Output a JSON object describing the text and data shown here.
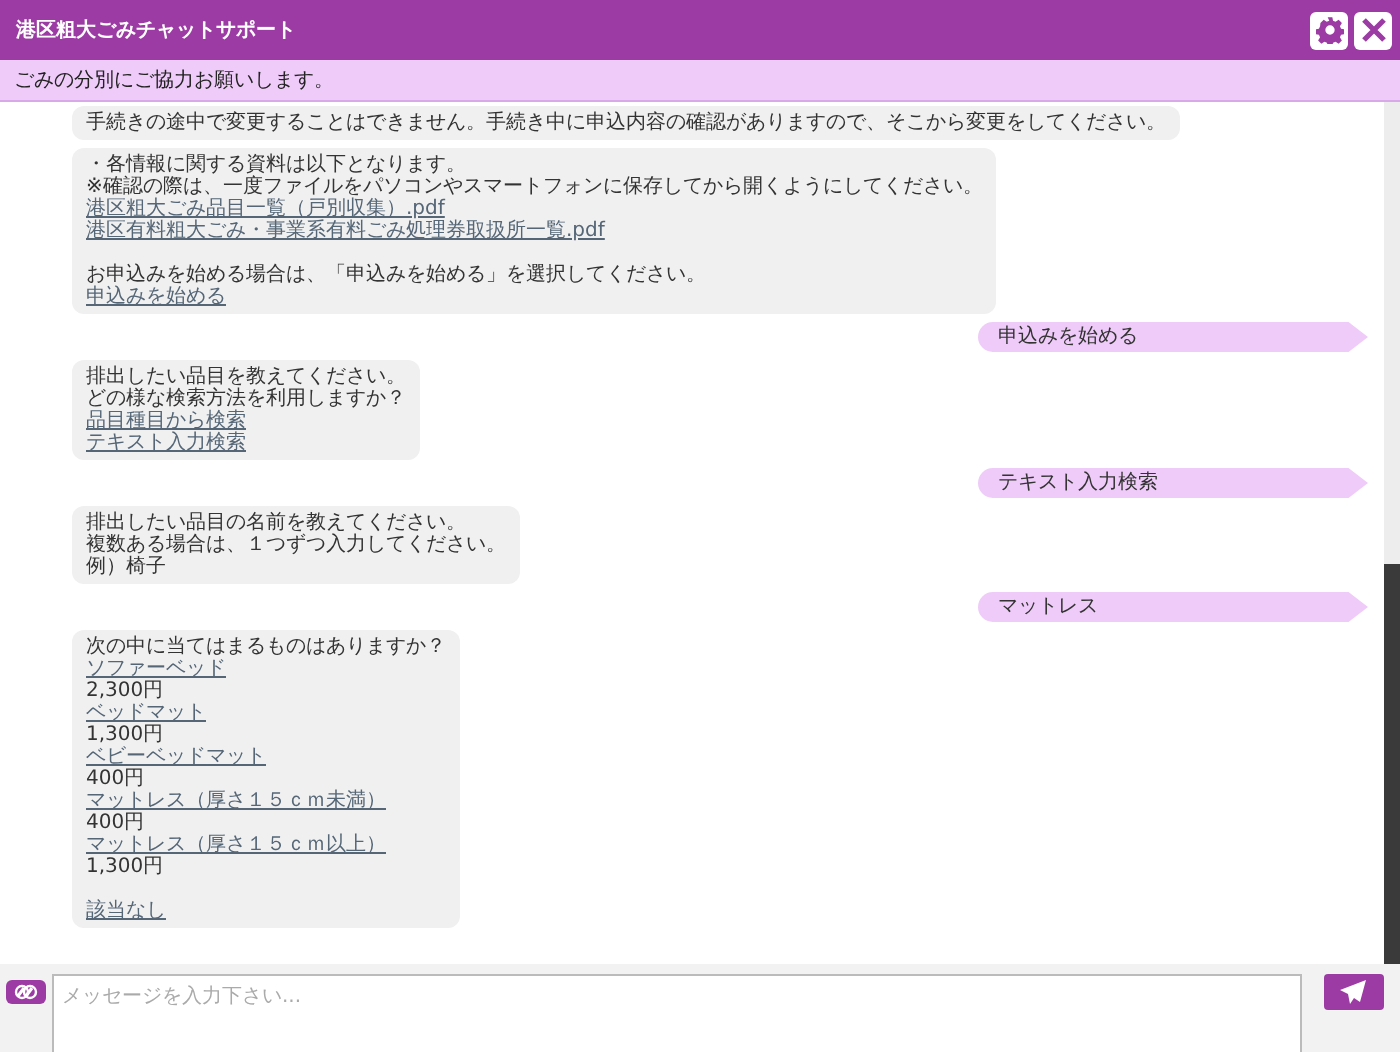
{
  "window": {
    "title": "港区粗大ごみチャットサポート"
  },
  "banner": "ごみの分別にご協力お願いします。",
  "messages": [
    {
      "kind": "bot",
      "lines": [
        {
          "kind": "text",
          "text": "手続きの途中で変更することはできません。手続き中に申込内容の確認がありますので、そこから変更をしてください。"
        }
      ]
    },
    {
      "kind": "bot",
      "lines": [
        {
          "kind": "text",
          "text": "・各情報に関する資料は以下となります。"
        },
        {
          "kind": "text",
          "text": "※確認の際は、一度ファイルをパソコンやスマートフォンに保存してから開くようにしてください。"
        },
        {
          "kind": "link",
          "text": "港区粗大ごみ品目一覧（戸別収集）.pdf"
        },
        {
          "kind": "link",
          "text": "港区有料粗大ごみ・事業系有料ごみ処理券取扱所一覧.pdf"
        },
        {
          "kind": "gap"
        },
        {
          "kind": "text",
          "text": "お申込みを始める場合は、「申込みを始める」を選択してください。"
        },
        {
          "kind": "link",
          "text": "申込みを始める"
        }
      ]
    },
    {
      "kind": "user",
      "text": "申込みを始める"
    },
    {
      "kind": "bot",
      "lines": [
        {
          "kind": "text",
          "text": "排出したい品目を教えてください。"
        },
        {
          "kind": "text",
          "text": "どの様な検索方法を利用しますか？"
        },
        {
          "kind": "link",
          "text": "品目種目から検索"
        },
        {
          "kind": "link",
          "text": "テキスト入力検索"
        }
      ]
    },
    {
      "kind": "user",
      "text": "テキスト入力検索"
    },
    {
      "kind": "bot",
      "lines": [
        {
          "kind": "text",
          "text": "排出したい品目の名前を教えてください。"
        },
        {
          "kind": "text",
          "text": "複数ある場合は、１つずつ入力してください。"
        },
        {
          "kind": "text",
          "text": "例）椅子"
        }
      ]
    },
    {
      "kind": "user",
      "text": "マットレス"
    },
    {
      "kind": "bot",
      "lines": [
        {
          "kind": "text",
          "text": "次の中に当てはまるものはありますか？"
        },
        {
          "kind": "link",
          "text": "ソファーベッド"
        },
        {
          "kind": "text",
          "text": "2,300円"
        },
        {
          "kind": "link",
          "text": "ベッドマット"
        },
        {
          "kind": "text",
          "text": "1,300円"
        },
        {
          "kind": "link",
          "text": "ベビーベッドマット"
        },
        {
          "kind": "text",
          "text": "400円"
        },
        {
          "kind": "link",
          "text": "マットレス（厚さ１５ｃｍ未満）"
        },
        {
          "kind": "text",
          "text": "400円"
        },
        {
          "kind": "link",
          "text": "マットレス（厚さ１５ｃｍ以上）"
        },
        {
          "kind": "text",
          "text": "1,300円"
        },
        {
          "kind": "gap"
        },
        {
          "kind": "link",
          "text": "該当なし"
        }
      ]
    }
  ],
  "composer": {
    "placeholder": "メッセージを入力下さい..."
  }
}
